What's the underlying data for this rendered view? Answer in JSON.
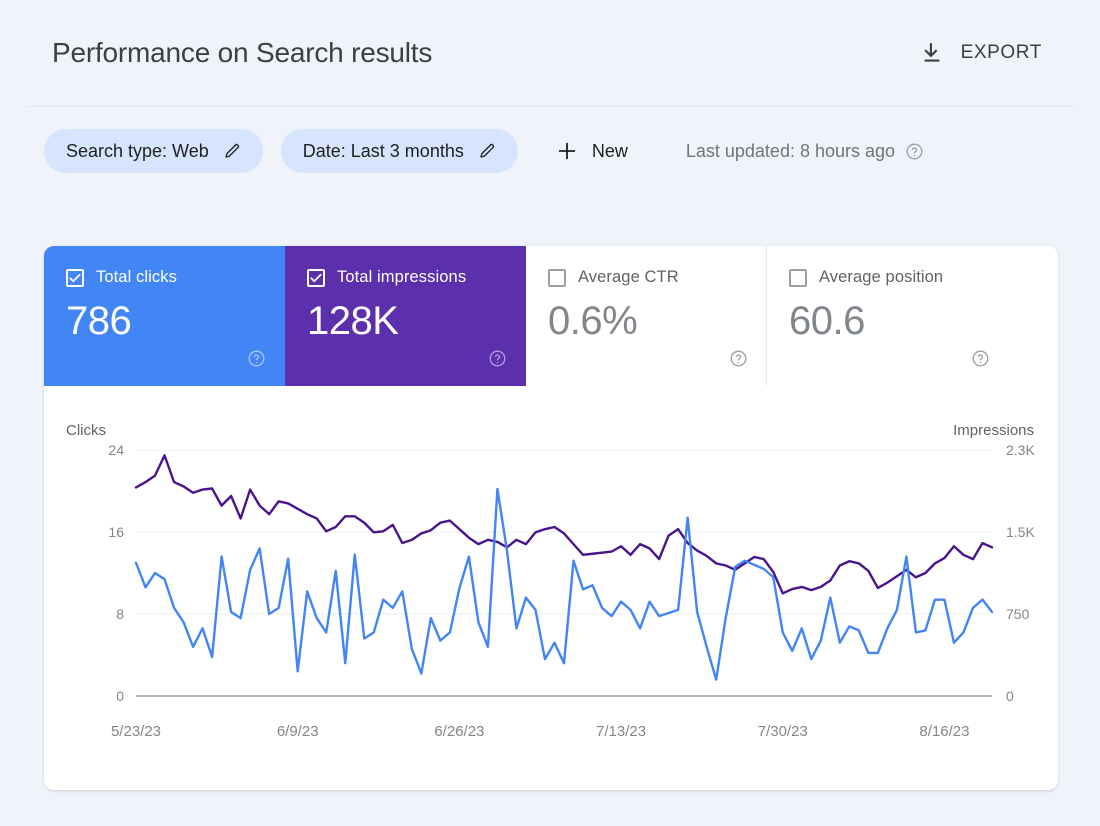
{
  "header": {
    "title": "Performance on Search results",
    "export_label": "EXPORT",
    "export_icon": "download-icon"
  },
  "filters": {
    "chips": [
      {
        "label": "Search type: Web",
        "icon": "pencil-icon"
      },
      {
        "label": "Date: Last 3 months",
        "icon": "pencil-icon"
      }
    ],
    "new_label": "New",
    "new_icon": "plus-icon",
    "last_updated": "Last updated: 8 hours ago",
    "help_icon": "help-circle-icon"
  },
  "metrics": [
    {
      "name": "Total clicks",
      "value": "786",
      "checked": true,
      "color": "#4285f4"
    },
    {
      "name": "Total impressions",
      "value": "128K",
      "checked": true,
      "color": "#5c2fad"
    },
    {
      "name": "Average CTR",
      "value": "0.6%",
      "checked": false,
      "color": "#ffffff"
    },
    {
      "name": "Average position",
      "value": "60.6",
      "checked": false,
      "color": "#ffffff"
    }
  ],
  "chart_data": {
    "type": "line",
    "title": "",
    "xlabel": "",
    "ylabel": "Clicks",
    "y2label": "Impressions",
    "grid": true,
    "legend": "none",
    "left_axis": {
      "label": "Clicks",
      "ticks": [
        "0",
        "8",
        "16",
        "24"
      ],
      "ylim": [
        0,
        24
      ]
    },
    "right_axis": {
      "label": "Impressions",
      "ticks": [
        "0",
        "750",
        "1.5K",
        "2.3K"
      ],
      "ylim": [
        0,
        2300
      ]
    },
    "x_ticks": [
      "5/23/23",
      "6/9/23",
      "6/26/23",
      "7/13/23",
      "7/30/23",
      "8/16/23"
    ],
    "x_tick_index": [
      0,
      17,
      34,
      51,
      68,
      85
    ],
    "series": [
      {
        "name": "Total clicks",
        "color": "#4285f4",
        "axis": "left",
        "values": [
          13,
          10.6,
          12,
          11.4,
          8.6,
          7.2,
          4.8,
          6.6,
          3.8,
          13.6,
          8.2,
          7.6,
          12.3,
          14.4,
          8,
          8.6,
          13.4,
          2.4,
          10.2,
          7.6,
          6.2,
          12.2,
          3.2,
          13.8,
          5.6,
          6.2,
          9.4,
          8.6,
          10.2,
          4.6,
          2.2,
          7.6,
          5.4,
          6.2,
          10.5,
          13.6,
          7.2,
          4.8,
          20.2,
          14.2,
          6.6,
          9.6,
          8.4,
          3.6,
          5.2,
          3.2,
          13.2,
          10.4,
          10.8,
          8.6,
          7.8,
          9.2,
          8.4,
          6.6,
          9.2,
          7.8,
          8.1,
          8.4,
          17.4,
          8.2,
          4.8,
          1.6,
          7.6,
          12.6,
          13.2,
          12.8,
          12.4,
          11.6,
          6.2,
          4.4,
          6.6,
          3.6,
          5.4,
          9.6,
          5.2,
          6.8,
          6.4,
          4.2,
          4.2,
          6.6,
          8.4,
          13.6,
          6.2,
          6.4,
          9.4,
          9.4,
          5.2,
          6.2,
          8.6,
          9.4,
          8.2
        ]
      },
      {
        "name": "Total impressions",
        "color": "#4a148c",
        "axis": "right",
        "values": [
          1950,
          2000,
          2060,
          2250,
          2000,
          1960,
          1900,
          1930,
          1940,
          1780,
          1870,
          1660,
          1930,
          1780,
          1700,
          1820,
          1800,
          1750,
          1700,
          1660,
          1540,
          1580,
          1680,
          1680,
          1620,
          1530,
          1540,
          1600,
          1430,
          1460,
          1520,
          1550,
          1620,
          1640,
          1560,
          1480,
          1420,
          1460,
          1440,
          1390,
          1460,
          1420,
          1530,
          1560,
          1580,
          1520,
          1420,
          1320,
          1330,
          1340,
          1350,
          1400,
          1320,
          1420,
          1380,
          1280,
          1500,
          1560,
          1430,
          1360,
          1310,
          1240,
          1220,
          1180,
          1240,
          1300,
          1280,
          1160,
          960,
          1000,
          1020,
          990,
          1020,
          1080,
          1220,
          1260,
          1240,
          1170,
          1010,
          1060,
          1120,
          1180,
          1110,
          1150,
          1240,
          1290,
          1400,
          1320,
          1280,
          1430,
          1390
        ]
      }
    ]
  }
}
